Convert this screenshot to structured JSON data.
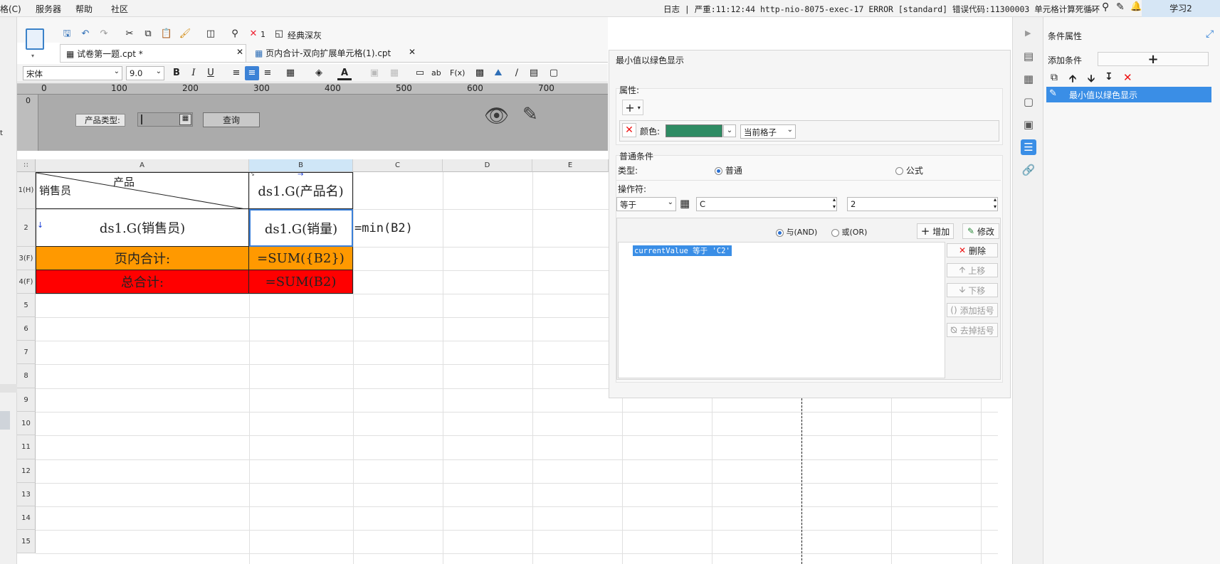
{
  "menubar": {
    "cut_label": "格(C)",
    "items": [
      "服务器",
      "帮助",
      "社区"
    ],
    "log": "日志 | 严重:11:12:44 http-nio-8075-exec-17 ERROR [standard] 错误代码:11300003 单元格计算死循环",
    "log_more": "...",
    "study": "学习2"
  },
  "left_strip": {
    "char": "t"
  },
  "toolbar": {
    "error_count": "1",
    "theme_label": "经典深灰"
  },
  "tabs": [
    {
      "label": "试卷第一题.cpt *"
    },
    {
      "label": "页内合计-双向扩展单元格(1).cpt"
    }
  ],
  "format": {
    "font": "宋体",
    "size": "9.0",
    "bold": "B",
    "italic": "I",
    "underline": "U",
    "ab": "ab",
    "fx": "F(x)"
  },
  "param_panel": {
    "ruler_ticks": [
      "0",
      "100",
      "200",
      "300",
      "400",
      "500",
      "600",
      "700"
    ],
    "label": "产品类型:",
    "query_button": "查询",
    "vruler": "0"
  },
  "grid": {
    "columns": [
      "A",
      "B",
      "C",
      "D",
      "E"
    ],
    "rows": [
      "1(H)",
      "2",
      "3(F)",
      "4(F)",
      "5",
      "6",
      "7",
      "8",
      "9",
      "10",
      "11",
      "12",
      "13",
      "14",
      "15"
    ],
    "a1_top": "产品",
    "a1_bottom": "销售员",
    "b1": "ds1.G(产品名)",
    "a2": "ds1.G(销售员)",
    "b2": "ds1.G(销量)",
    "c2": "=min(B2)",
    "a3": "页内合计:",
    "b3": "=SUM({B2})",
    "a4": "总合计:",
    "b4": "=SUM(B2)"
  },
  "colors": {
    "orange": "#ff9900",
    "red": "#ff0000",
    "green_swatch": "#2e8b63",
    "selected_blue": "#3a8ee6"
  },
  "dialog": {
    "title": "最小值以绿色显示",
    "attr_section": "属性:",
    "color_label": "颜色:",
    "scope": "当前格子",
    "normal_section": "普通条件",
    "type_label": "类型:",
    "type_normal": "普通",
    "type_formula": "公式",
    "operator_label": "操作符:",
    "operator": "等于",
    "field_value": "C",
    "value2": "2",
    "and_label": "与(AND)",
    "or_label": "或(OR)",
    "add_button": "增加",
    "modify_button": "修改",
    "condition_text": "currentValue 等于 'C2'",
    "delete_button": "删除",
    "up_button": "上移",
    "down_button": "下移",
    "add_paren_button": "添加括号",
    "remove_paren_button": "去掉括号"
  },
  "props": {
    "title": "条件属性",
    "add_condition_label": "添加条件",
    "add_plus": "+",
    "selected_item": "最小值以绿色显示"
  }
}
